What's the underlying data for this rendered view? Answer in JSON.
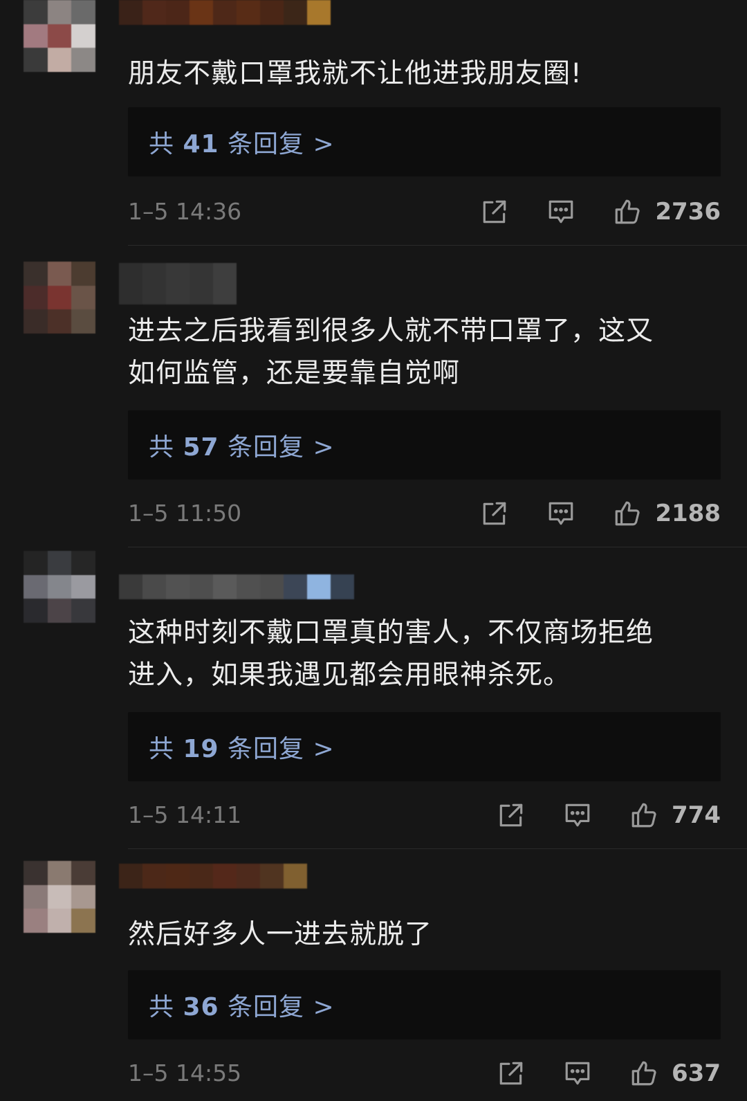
{
  "comments": [
    {
      "text": "朋友不戴口罩我就不让他进我朋友圈!",
      "replies_prefix": "共",
      "replies_count": "41",
      "replies_suffix": "条回复 >",
      "time": "1–5 14:36",
      "likes": "2736"
    },
    {
      "text": "进去之后我看到很多人就不带口罩了，这又\n如何监管，还是要靠自觉啊",
      "replies_prefix": "共",
      "replies_count": "57",
      "replies_suffix": "条回复 >",
      "time": "1–5 11:50",
      "likes": "2188"
    },
    {
      "text": "这种时刻不戴口罩真的害人，不仅商场拒绝\n进入，如果我遇见都会用眼神杀死。",
      "replies_prefix": "共",
      "replies_count": "19",
      "replies_suffix": "条回复 >",
      "time": "1–5 14:11",
      "likes": "774"
    },
    {
      "text": "然后好多人一进去就脱了",
      "replies_prefix": "共",
      "replies_count": "36",
      "replies_suffix": "条回复 >",
      "time": "1–5 14:55",
      "likes": "637"
    }
  ],
  "icons": {
    "share": "share-icon",
    "reply": "comment-icon",
    "like": "thumbs-up-icon"
  },
  "colors": {
    "background": "#161616",
    "reply_box": "#0d0d0d",
    "reply_link": "#8ea7d3",
    "meta_text": "#7a7a7a"
  }
}
